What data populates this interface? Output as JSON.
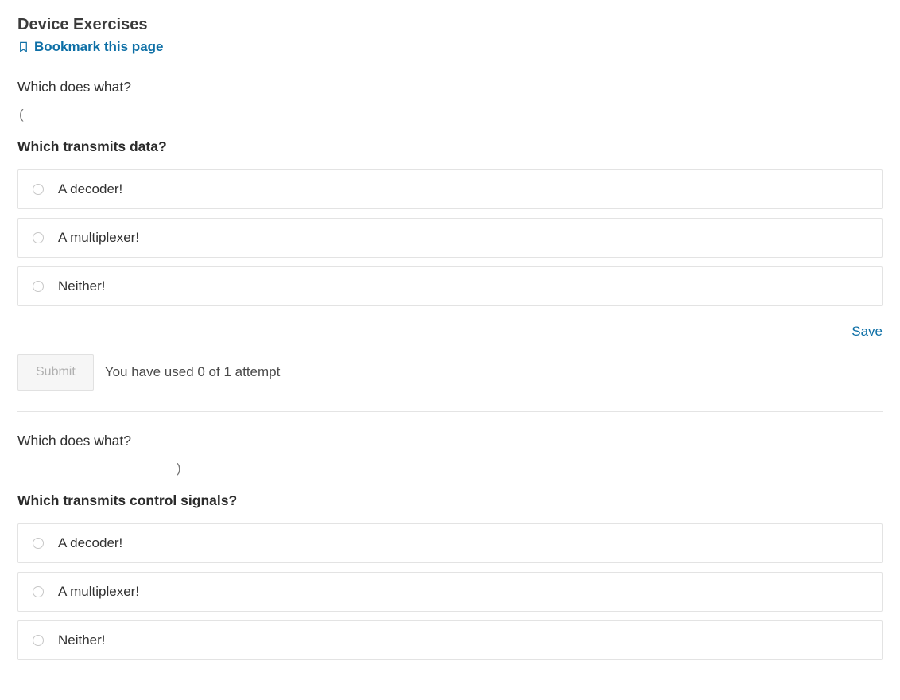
{
  "header": {
    "title": "Device Exercises",
    "bookmark_label": "Bookmark this page"
  },
  "actions": {
    "save_label": "Save",
    "submit_label": "Submit"
  },
  "questions": [
    {
      "group_label": "Which does what?",
      "paren": "(",
      "prompt": "Which transmits data?",
      "choices": [
        "A decoder!",
        "A multiplexer!",
        "Neither!"
      ],
      "attempts_text": "You have used 0 of 1 attempt"
    },
    {
      "group_label": "Which does what?",
      "paren": ")",
      "prompt": "Which transmits control signals?",
      "choices": [
        "A decoder!",
        "A multiplexer!",
        "Neither!"
      ]
    }
  ]
}
